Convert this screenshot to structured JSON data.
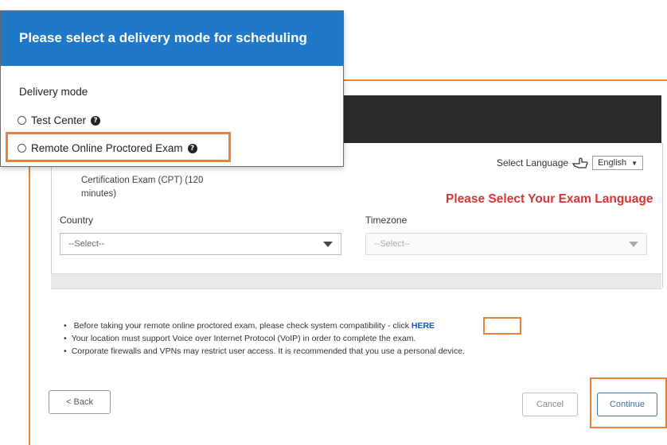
{
  "modal": {
    "title": "Please select a delivery mode for scheduling",
    "delivery_mode_label": "Delivery mode",
    "options": [
      {
        "label": "Test Center",
        "selected": false
      },
      {
        "label": "Remote Online Proctored Exam",
        "selected": false
      }
    ]
  },
  "form": {
    "exam_name": "Certification Exam (CPT) (120 minutes)",
    "select_language_label": "Select Language",
    "language_value": "English",
    "please_select_language": "Please Select Your Exam Language",
    "country_label": "Country",
    "country_value": "--Select--",
    "timezone_label": "Timezone",
    "timezone_value": "--Select--"
  },
  "notes": {
    "bullet1_text": "Before taking your remote online proctored exam, please check system compatibility - click ",
    "bullet1_link": "HERE",
    "bullet2": "Your location must support Voice over Internet Protocol (VoIP) in order to complete the exam.",
    "bullet3": "Corporate firewalls and VPNs may restrict user access. It is recommended that you use a personal device."
  },
  "buttons": {
    "back": "< Back",
    "cancel": "Cancel",
    "continue": "Continue"
  },
  "colors": {
    "accent_blue": "#1f78c8",
    "highlight_orange": "#e8823a",
    "warning_red": "#d93434"
  }
}
